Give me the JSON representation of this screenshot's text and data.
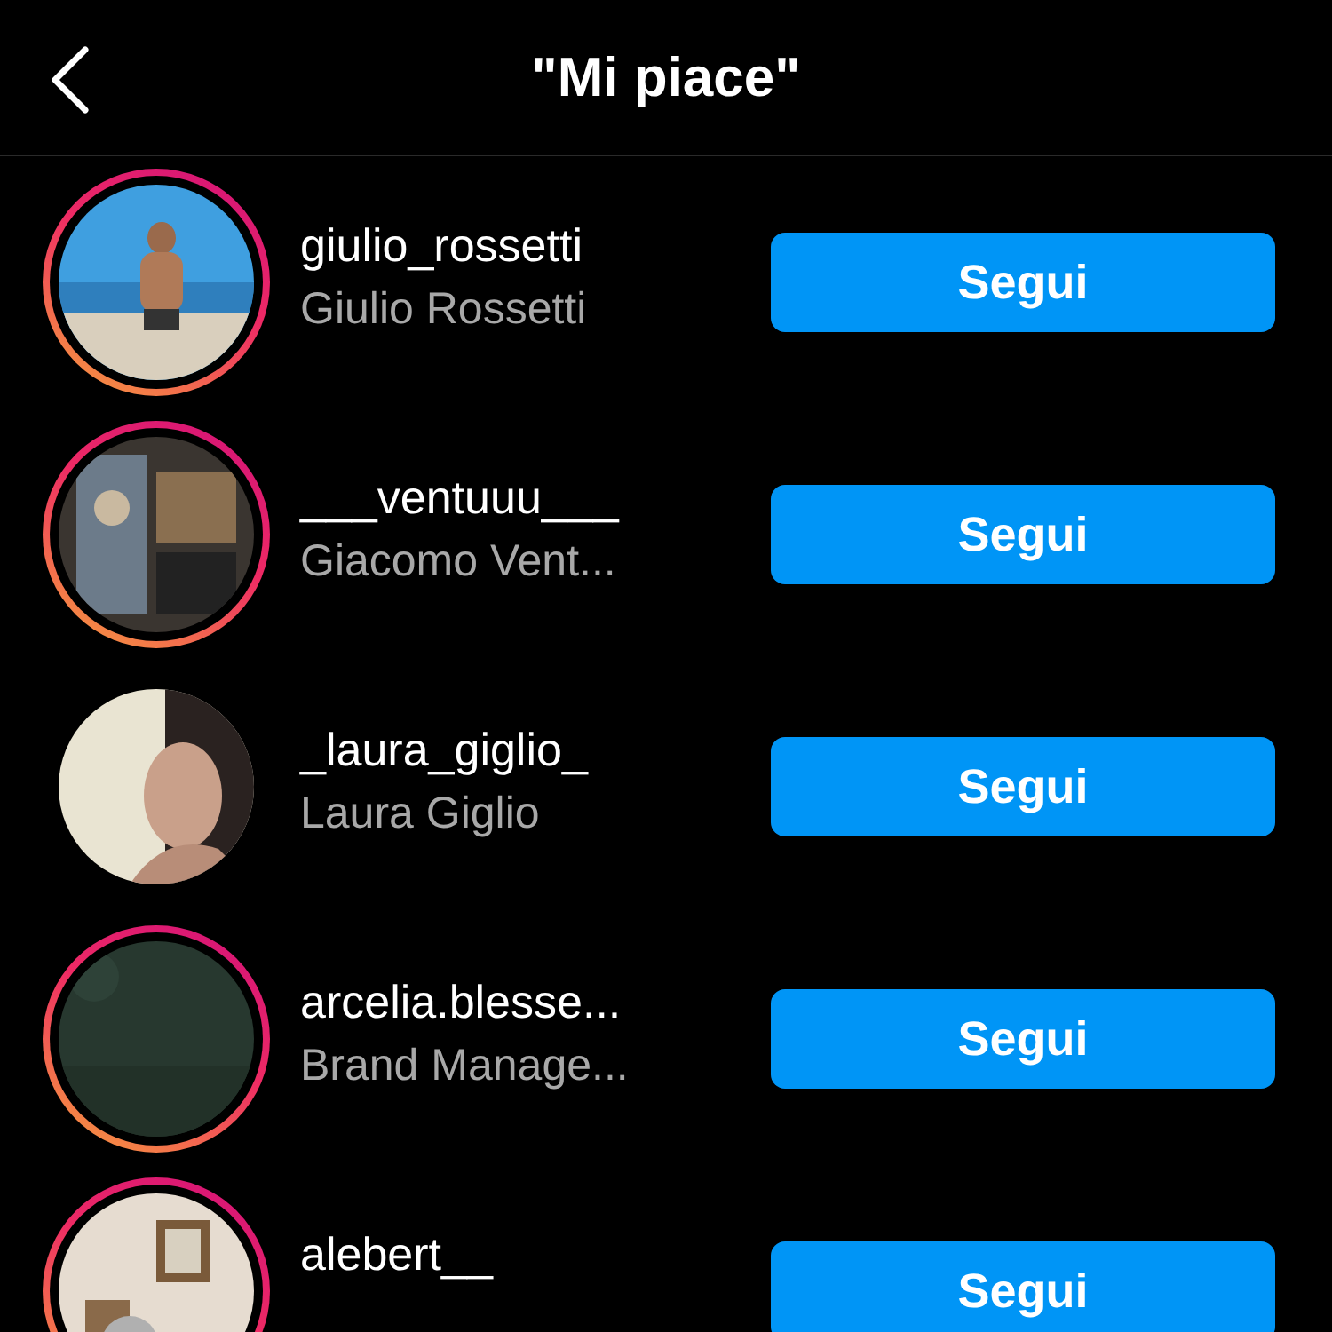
{
  "header": {
    "title": "\"Mi piace\""
  },
  "users": [
    {
      "username": "giulio_rossetti",
      "name": "Giulio Rossetti",
      "story_ring": true,
      "button": "Segui"
    },
    {
      "username": "___ventuuu___",
      "name": "Giacomo Vent...",
      "story_ring": true,
      "button": "Segui"
    },
    {
      "username": "_laura_giglio_",
      "name": "Laura Giglio",
      "story_ring": false,
      "button": "Segui"
    },
    {
      "username": "arcelia.blesse...",
      "name": "Brand Manage...",
      "story_ring": true,
      "button": "Segui"
    },
    {
      "username": "alebert__",
      "story_ring": true,
      "button": "Segui"
    }
  ]
}
